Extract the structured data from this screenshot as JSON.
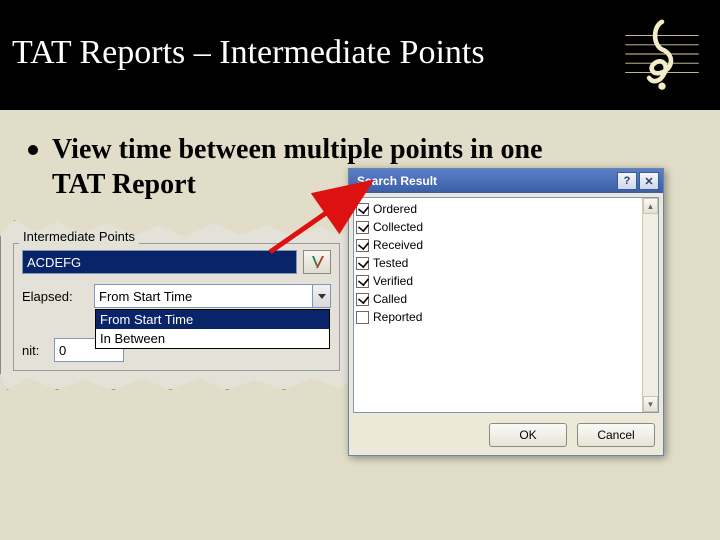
{
  "header": {
    "title": "TAT Reports – Intermediate Points"
  },
  "bullet": {
    "text": "View time between multiple points in one TAT Report"
  },
  "left_dialog": {
    "group_label": "Intermediate Points",
    "code_value": "ACDEFG",
    "elapsed_label": "Elapsed:",
    "elapsed_value": "From Start Time",
    "elapsed_options": [
      "From Start Time",
      "In Between"
    ],
    "nit_label": "nit:",
    "nit_value": "0"
  },
  "search_win": {
    "title": "Search Result",
    "help_symbol": "?",
    "close_symbol": "✕",
    "items": [
      {
        "label": "Ordered",
        "checked": true
      },
      {
        "label": "Collected",
        "checked": true
      },
      {
        "label": "Received",
        "checked": true
      },
      {
        "label": "Tested",
        "checked": true
      },
      {
        "label": "Verified",
        "checked": true
      },
      {
        "label": "Called",
        "checked": true
      },
      {
        "label": "Reported",
        "checked": false
      }
    ],
    "ok_label": "OK",
    "cancel_label": "Cancel",
    "scroll_up": "▲",
    "scroll_down": "▼"
  }
}
